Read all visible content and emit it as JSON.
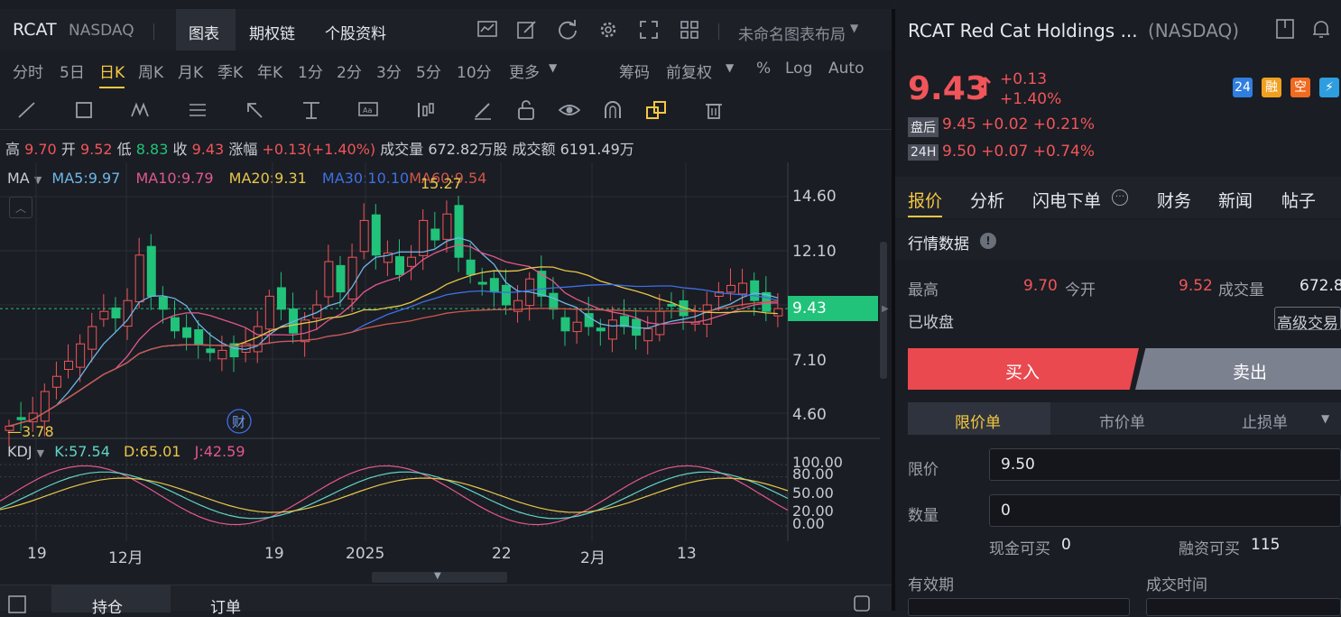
{
  "header": {
    "symbol": "RCAT",
    "exchange": "NASDAQ",
    "tabs": [
      "图表",
      "期权链",
      "个股资料"
    ],
    "layout_name": "未命名图表布局"
  },
  "timeframes": [
    "分时",
    "5日",
    "日K",
    "周K",
    "月K",
    "季K",
    "年K",
    "1分",
    "2分",
    "3分",
    "5分",
    "10分",
    "更多"
  ],
  "timeframe_active": "日K",
  "right_tools": [
    "筹码",
    "前复权",
    "%",
    "Log",
    "Auto"
  ],
  "ohlc": {
    "high_label": "高",
    "high": "9.70",
    "open_label": "开",
    "open": "9.52",
    "low_label": "低",
    "low": "8.83",
    "close_label": "收",
    "close": "9.43",
    "change_label": "涨幅",
    "change": "+0.13(+1.40%)",
    "volume_label": "成交量",
    "volume": "672.82万股",
    "amount_label": "成交额",
    "amount": "6191.49万"
  },
  "ma": {
    "label": "MA",
    "ma5": "MA5:9.97",
    "ma10": "MA10:9.79",
    "ma20": "MA20:9.31",
    "ma30": "MA30:10.10",
    "ma60": "MA60:9.54",
    "max_annot": "15.27",
    "min_annot": "3.78"
  },
  "price_axis": [
    "14.60",
    "12.10",
    "9.43",
    "7.10",
    "4.60"
  ],
  "kdj": {
    "label": "KDJ",
    "k": "K:57.54",
    "d": "D:65.01",
    "j": "J:42.59",
    "axis": [
      "100.00",
      "80.00",
      "50.00",
      "20.00",
      "0.00"
    ]
  },
  "x_axis": [
    "19",
    "12月",
    "19",
    "2025",
    "22",
    "2月",
    "13"
  ],
  "caiicon": "财",
  "bottom_tabs": [
    "持仓",
    "订单"
  ],
  "right": {
    "title": "RCAT Red Cat Holdings ...",
    "exchange": "(NASDAQ)",
    "price": "9.43",
    "change": "+0.13",
    "change_pct": "+1.40%",
    "after_label": "盘后",
    "after": "9.45 +0.02 +0.21%",
    "h24_label": "24H",
    "h24": "9.50 +0.07 +0.74%",
    "badges": [
      "24",
      "融",
      "空",
      "⚡"
    ],
    "tabs": [
      "报价",
      "分析",
      "闪电下单",
      "财务",
      "新闻",
      "帖子"
    ],
    "section": "行情数据",
    "high_label": "最高",
    "high": "9.70",
    "open_label": "今开",
    "open": "9.52",
    "vol_label": "成交量",
    "vol": "672.8",
    "status": "已收盘",
    "adv": "高级交易",
    "buy": "买入",
    "sell": "卖出",
    "order_tabs": [
      "限价单",
      "市价单",
      "止损单"
    ],
    "limit_label": "限价",
    "limit_value": "9.50",
    "qty_label": "数量",
    "qty_value": "0",
    "cash_label": "现金可买",
    "cash_value": "0",
    "margin_label": "融资可买",
    "margin_value": "115",
    "valid_label": "有效期",
    "time_label": "成交时间"
  },
  "colors": {
    "up": "#f0555a",
    "down": "#21c27a",
    "ma5": "#6fb6e8",
    "ma10": "#e0588c",
    "ma20": "#e8c64a",
    "ma30": "#3f6fe6",
    "ma60": "#d0564a"
  }
}
